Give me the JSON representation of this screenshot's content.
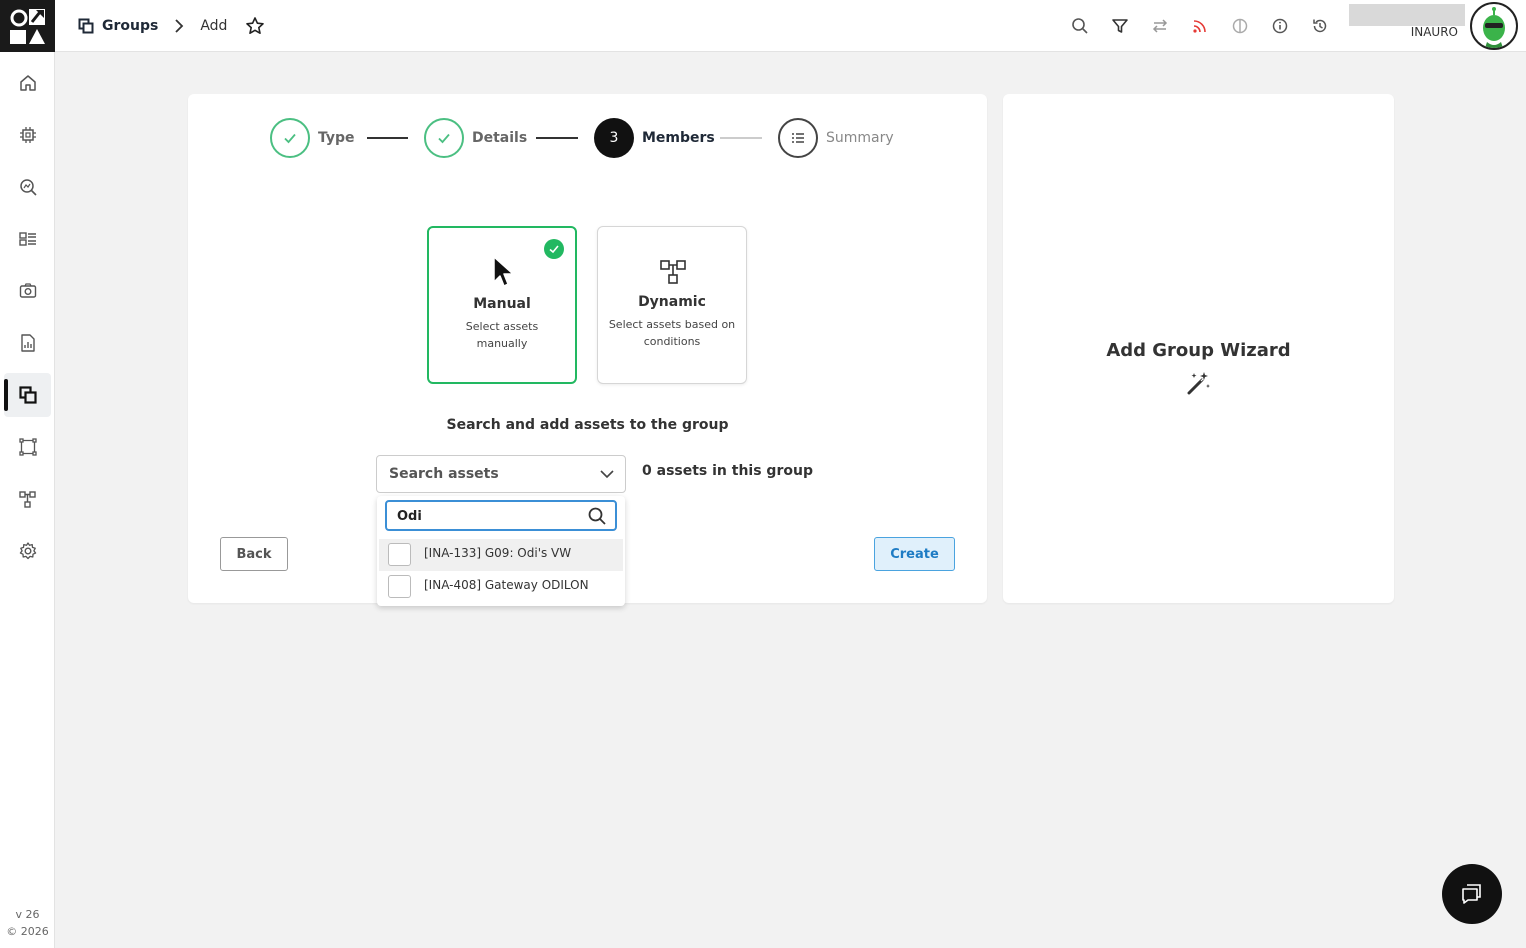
{
  "breadcrumb": {
    "section": "Groups",
    "current": "Add"
  },
  "user": {
    "name": "INAURO"
  },
  "sidebar": {
    "items": [
      {
        "icon": "home-icon"
      },
      {
        "icon": "chip-icon"
      },
      {
        "icon": "search-analytics-icon"
      },
      {
        "icon": "dashboard-icon"
      },
      {
        "icon": "camera-icon"
      },
      {
        "icon": "report-icon"
      },
      {
        "icon": "groups-icon",
        "active": true
      },
      {
        "icon": "frame-icon"
      },
      {
        "icon": "hierarchy-icon"
      },
      {
        "icon": "settings-icon"
      }
    ],
    "version": "v 26",
    "copyright": "© 2026"
  },
  "stepper": {
    "steps": [
      {
        "label": "Type",
        "state": "done"
      },
      {
        "label": "Details",
        "state": "done"
      },
      {
        "label": "Members",
        "state": "current",
        "number": "3"
      },
      {
        "label": "Summary",
        "state": "todo"
      }
    ]
  },
  "options": {
    "manual": {
      "title": "Manual",
      "desc": "Select assets manually",
      "selected": true
    },
    "dynamic": {
      "title": "Dynamic",
      "desc": "Select assets based on conditions"
    }
  },
  "members": {
    "heading": "Search and add assets to the group",
    "select_placeholder": "Search assets",
    "count_text": "0 assets in this group"
  },
  "dropdown": {
    "query": "Odi",
    "results": [
      {
        "label": "[INA-133] G09: Odi's VW"
      },
      {
        "label": "[INA-408] Gateway ODILON"
      }
    ]
  },
  "buttons": {
    "back": "Back",
    "create": "Create"
  },
  "wizard": {
    "title": "Add Group Wizard"
  },
  "colors": {
    "success": "#22b861",
    "primary": "#1e7cc4",
    "dark": "#111111"
  }
}
